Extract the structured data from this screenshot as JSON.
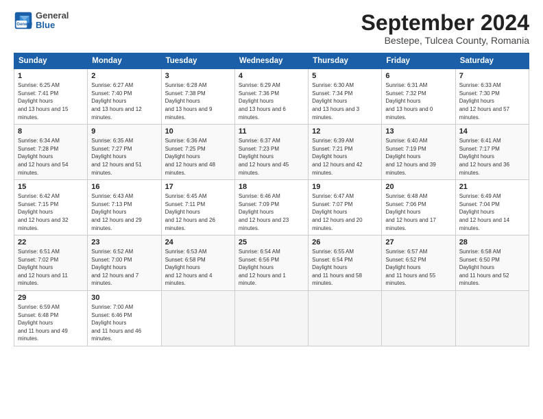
{
  "header": {
    "logo_general": "General",
    "logo_blue": "Blue",
    "month_title": "September 2024",
    "location": "Bestepe, Tulcea County, Romania"
  },
  "calendar": {
    "days_of_week": [
      "Sunday",
      "Monday",
      "Tuesday",
      "Wednesday",
      "Thursday",
      "Friday",
      "Saturday"
    ],
    "weeks": [
      [
        {
          "day": "1",
          "sunrise": "6:25 AM",
          "sunset": "7:41 PM",
          "daylight": "13 hours and 15 minutes."
        },
        {
          "day": "2",
          "sunrise": "6:27 AM",
          "sunset": "7:40 PM",
          "daylight": "13 hours and 12 minutes."
        },
        {
          "day": "3",
          "sunrise": "6:28 AM",
          "sunset": "7:38 PM",
          "daylight": "13 hours and 9 minutes."
        },
        {
          "day": "4",
          "sunrise": "6:29 AM",
          "sunset": "7:36 PM",
          "daylight": "13 hours and 6 minutes."
        },
        {
          "day": "5",
          "sunrise": "6:30 AM",
          "sunset": "7:34 PM",
          "daylight": "13 hours and 3 minutes."
        },
        {
          "day": "6",
          "sunrise": "6:31 AM",
          "sunset": "7:32 PM",
          "daylight": "13 hours and 0 minutes."
        },
        {
          "day": "7",
          "sunrise": "6:33 AM",
          "sunset": "7:30 PM",
          "daylight": "12 hours and 57 minutes."
        }
      ],
      [
        {
          "day": "8",
          "sunrise": "6:34 AM",
          "sunset": "7:28 PM",
          "daylight": "12 hours and 54 minutes."
        },
        {
          "day": "9",
          "sunrise": "6:35 AM",
          "sunset": "7:27 PM",
          "daylight": "12 hours and 51 minutes."
        },
        {
          "day": "10",
          "sunrise": "6:36 AM",
          "sunset": "7:25 PM",
          "daylight": "12 hours and 48 minutes."
        },
        {
          "day": "11",
          "sunrise": "6:37 AM",
          "sunset": "7:23 PM",
          "daylight": "12 hours and 45 minutes."
        },
        {
          "day": "12",
          "sunrise": "6:39 AM",
          "sunset": "7:21 PM",
          "daylight": "12 hours and 42 minutes."
        },
        {
          "day": "13",
          "sunrise": "6:40 AM",
          "sunset": "7:19 PM",
          "daylight": "12 hours and 39 minutes."
        },
        {
          "day": "14",
          "sunrise": "6:41 AM",
          "sunset": "7:17 PM",
          "daylight": "12 hours and 36 minutes."
        }
      ],
      [
        {
          "day": "15",
          "sunrise": "6:42 AM",
          "sunset": "7:15 PM",
          "daylight": "12 hours and 32 minutes."
        },
        {
          "day": "16",
          "sunrise": "6:43 AM",
          "sunset": "7:13 PM",
          "daylight": "12 hours and 29 minutes."
        },
        {
          "day": "17",
          "sunrise": "6:45 AM",
          "sunset": "7:11 PM",
          "daylight": "12 hours and 26 minutes."
        },
        {
          "day": "18",
          "sunrise": "6:46 AM",
          "sunset": "7:09 PM",
          "daylight": "12 hours and 23 minutes."
        },
        {
          "day": "19",
          "sunrise": "6:47 AM",
          "sunset": "7:07 PM",
          "daylight": "12 hours and 20 minutes."
        },
        {
          "day": "20",
          "sunrise": "6:48 AM",
          "sunset": "7:06 PM",
          "daylight": "12 hours and 17 minutes."
        },
        {
          "day": "21",
          "sunrise": "6:49 AM",
          "sunset": "7:04 PM",
          "daylight": "12 hours and 14 minutes."
        }
      ],
      [
        {
          "day": "22",
          "sunrise": "6:51 AM",
          "sunset": "7:02 PM",
          "daylight": "12 hours and 11 minutes."
        },
        {
          "day": "23",
          "sunrise": "6:52 AM",
          "sunset": "7:00 PM",
          "daylight": "12 hours and 7 minutes."
        },
        {
          "day": "24",
          "sunrise": "6:53 AM",
          "sunset": "6:58 PM",
          "daylight": "12 hours and 4 minutes."
        },
        {
          "day": "25",
          "sunrise": "6:54 AM",
          "sunset": "6:56 PM",
          "daylight": "12 hours and 1 minute."
        },
        {
          "day": "26",
          "sunrise": "6:55 AM",
          "sunset": "6:54 PM",
          "daylight": "11 hours and 58 minutes."
        },
        {
          "day": "27",
          "sunrise": "6:57 AM",
          "sunset": "6:52 PM",
          "daylight": "11 hours and 55 minutes."
        },
        {
          "day": "28",
          "sunrise": "6:58 AM",
          "sunset": "6:50 PM",
          "daylight": "11 hours and 52 minutes."
        }
      ],
      [
        {
          "day": "29",
          "sunrise": "6:59 AM",
          "sunset": "6:48 PM",
          "daylight": "11 hours and 49 minutes."
        },
        {
          "day": "30",
          "sunrise": "7:00 AM",
          "sunset": "6:46 PM",
          "daylight": "11 hours and 46 minutes."
        },
        null,
        null,
        null,
        null,
        null
      ]
    ]
  }
}
